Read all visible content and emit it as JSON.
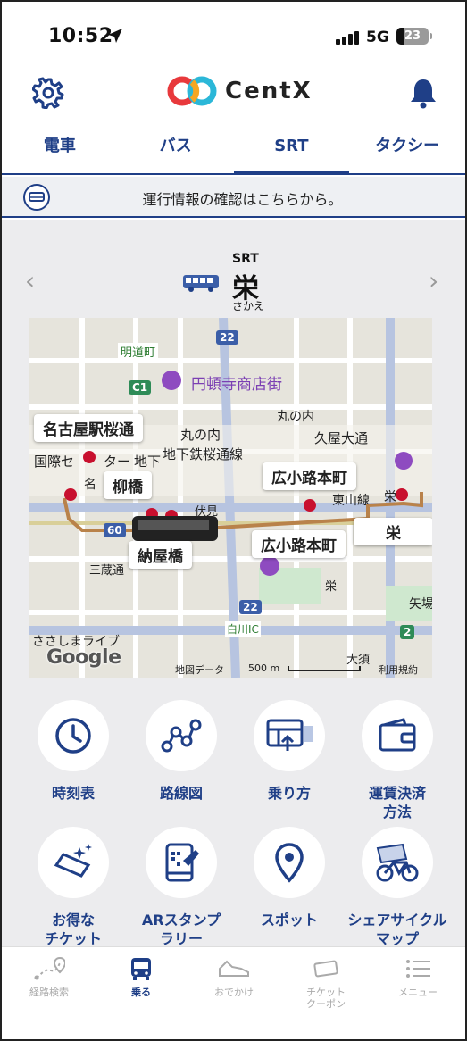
{
  "status_bar": {
    "time": "10:52",
    "network": "5G",
    "battery": "23"
  },
  "header": {
    "logo_text": "CentX"
  },
  "tabs": [
    {
      "label": "電車"
    },
    {
      "label": "バス"
    },
    {
      "label": "SRT"
    },
    {
      "label": "タクシー"
    }
  ],
  "info_banner": {
    "text": "運行情報の確認はこちらから。"
  },
  "station": {
    "service": "SRT",
    "name": "栄",
    "kana": "さかえ"
  },
  "map": {
    "labels": {
      "meidocho": "明道町",
      "entonji": "円頓寺商店街",
      "marunouchi": "丸の内",
      "marunouchi2": "丸の内",
      "hisaya": "久屋大通",
      "sakuradori": "地下鉄桜通線",
      "kokusai": "国際セ",
      "kokusai2": "ター",
      "chika": "地下",
      "fushimi": "伏見",
      "higashiyama": "東山線",
      "sannomaru": "三蔵通",
      "sakae_small": "栄",
      "yaba": "矢場",
      "shirakawa": "白川IC",
      "ozu": "大須",
      "sasashima": "ささしまライブ",
      "na": "名",
      "sakae_l": "栄"
    },
    "boxes": {
      "meieki": "名古屋駅桜通",
      "yanagibashi": "柳橋",
      "hirokoji1": "広小路本町",
      "hirokoji2": "広小路本町",
      "nayabashi": "納屋橋",
      "sakae": "栄"
    },
    "badges": {
      "r22a": "22",
      "r22b": "22",
      "c1": "C1",
      "r60": "60",
      "g2": "2"
    },
    "google": "Google",
    "map_data": "地図データ",
    "scale": "500 m",
    "terms": "利用規約"
  },
  "features": [
    {
      "label": "時刻表",
      "icon": "clock-icon"
    },
    {
      "label": "路線図",
      "icon": "route-map-icon"
    },
    {
      "label": "乗り方",
      "icon": "boarding-icon"
    },
    {
      "label": "運賃決済\n方法",
      "label1": "運賃決済",
      "label2": "方法",
      "icon": "wallet-icon"
    },
    {
      "label1": "お得な",
      "label2": "チケット",
      "icon": "ticket-icon"
    },
    {
      "label1": "ARスタンプ",
      "label2": "ラリー",
      "icon": "ar-stamp-icon"
    },
    {
      "label1": "スポット",
      "label2": "",
      "icon": "location-pin-icon"
    },
    {
      "label1": "シェアサイクル",
      "label2": "マップ",
      "icon": "share-cycle-icon"
    }
  ],
  "bottom_nav": [
    {
      "label": "経路検索"
    },
    {
      "label": "乗る"
    },
    {
      "label": "おでかけ"
    },
    {
      "label1": "チケット",
      "label2": "クーポン"
    },
    {
      "label": "メニュー"
    }
  ],
  "colors": {
    "brand_navy": "#1f3f87",
    "route_brown": "#b9824a",
    "stop_red": "#c8102e"
  }
}
